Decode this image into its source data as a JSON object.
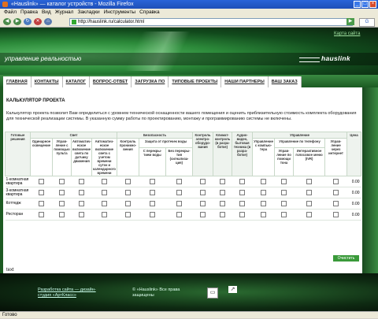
{
  "browser": {
    "title": "«Hauslink» — каталог устройств - Mozilla Firefox",
    "menu": [
      "Файл",
      "Правка",
      "Вид",
      "Журнал",
      "Закладки",
      "Инструменты",
      "Справка"
    ],
    "url": "http://hauslink.ru/calculator.html",
    "status": "Готово"
  },
  "site": {
    "sitemap_link": "Карта сайта",
    "tagline": "управление реальностью",
    "logo": "hauslink",
    "nav": [
      "ГЛАВНАЯ",
      "КОНТАКТЫ",
      "КАТАЛОГ",
      "ВОПРОС-ОТВЕТ",
      "ЗАГРУЗКА ПО",
      "ТИПОВЫЕ ПРОЕКТЫ",
      "НАШИ ПАРТНЕРЫ",
      "ВАШ ЗАКАЗ"
    ]
  },
  "page": {
    "title": "КАЛЬКУЛЯТОР ПРОЕКТА",
    "description": "Калькулятор проекта позволит Вам определиться с уровнем технической оснащенности вашего помещения и оценить приблизительную стоимость комплекта оборудования для технической реализации системы. В указанную сумму работы по проектированию, монтажу и программированию системы не включены."
  },
  "table": {
    "h_ready": "Готовые решения",
    "h_light": "Свет",
    "h_security": "Безопасность",
    "h_control": "Управление",
    "h_price": "Цена",
    "c_ceiling": "Одинарное освещение",
    "c_manual": "Управ-ление с помощью пульта",
    "c_auto": "Автоматич-еское включение света по датчику движения",
    "c_schedule": "Автоматич-еское включение света с учетом времени суток и календарного времени",
    "c_access": "Контроль проникно-вения",
    "c_leak": "Защита от протечек воды",
    "c_leak_a": "С перекры-тием воды",
    "c_leak_b": "Без перекры-тия (сигнализа-ция)",
    "c_electric": "Контроль электро-оборудо-вания",
    "c_climate": "Климат-контроль (в разра-ботке)",
    "c_audio": "Аудио-видео, бытовая техника (в разра-ботке)",
    "c_pc": "Управление с компью-тера",
    "c_phone": "Управление по телефону",
    "c_phone_a": "Управ-ление по помощи тона",
    "c_phone_b": "Интерактивное голосовое меню (IVR)",
    "c_internet": "Управ-ление через интернет",
    "rows": [
      {
        "name": "1-комнатная квартира",
        "total": "0.00"
      },
      {
        "name": "3-комнатная квартира",
        "total": "0.00"
      },
      {
        "name": "Коттедж",
        "total": "0.00"
      },
      {
        "name": "Ресторан",
        "total": "0.00"
      }
    ],
    "clear_button": "Очистить",
    "extra_text": "text"
  },
  "footer": {
    "dev_link": "Разработка сайта — дизайн-студия «АртКласс»",
    "copyright": "© «Hauslink» Все права защищены"
  }
}
